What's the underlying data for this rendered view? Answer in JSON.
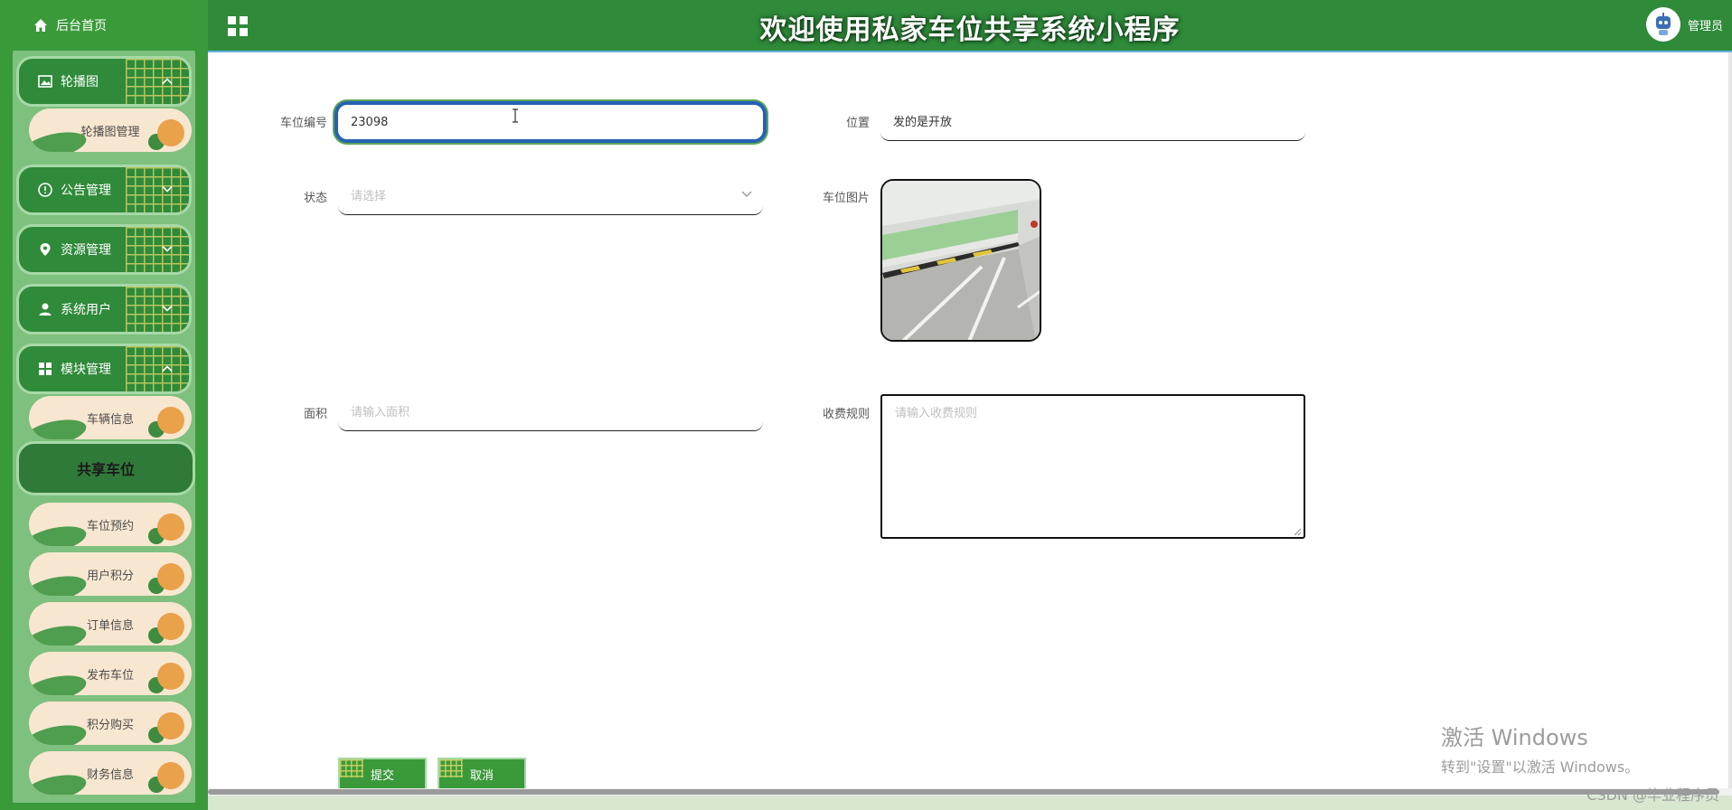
{
  "sidebar": {
    "home_label": "后台首页",
    "groups": [
      {
        "label": "轮播图",
        "icon": "image-icon",
        "chevron": "^"
      },
      {
        "label": "公告管理",
        "icon": "info-circle-icon",
        "chevron": "v"
      },
      {
        "label": "资源管理",
        "icon": "location-pin-icon",
        "chevron": "v"
      },
      {
        "label": "系统用户",
        "icon": "user-icon",
        "chevron": "v"
      },
      {
        "label": "模块管理",
        "icon": "grid-icon",
        "chevron": "^"
      }
    ],
    "carousel_items": [
      "轮播图管理"
    ],
    "module_items": [
      "车辆信息",
      "共享车位",
      "车位预约",
      "用户积分",
      "订单信息",
      "发布车位",
      "积分购买",
      "财务信息"
    ],
    "active_item": "共享车位"
  },
  "header": {
    "title": "欢迎使用私家车位共享系统小程序",
    "user_label": "管理员"
  },
  "form": {
    "space_number": {
      "label": "车位编号",
      "value": "23098"
    },
    "location": {
      "label": "位置",
      "value": "发的是开放"
    },
    "status": {
      "label": "状态",
      "placeholder": "请选择"
    },
    "image": {
      "label": "车位图片"
    },
    "area": {
      "label": "面积",
      "placeholder": "请输入面积"
    },
    "fee_rules": {
      "label": "收费规则",
      "placeholder": "请输入收费规则"
    },
    "submit_label": "提交",
    "cancel_label": "取消"
  },
  "watermark": {
    "line1": "激活 Windows",
    "line2": "转到\"设置\"以激活 Windows。",
    "csdn": "CSDN @毕业程序员"
  },
  "colors": {
    "header_green": "#2f8a3a",
    "sidebar_green": "#3a9a3a",
    "focus_blue": "#2462b3"
  }
}
